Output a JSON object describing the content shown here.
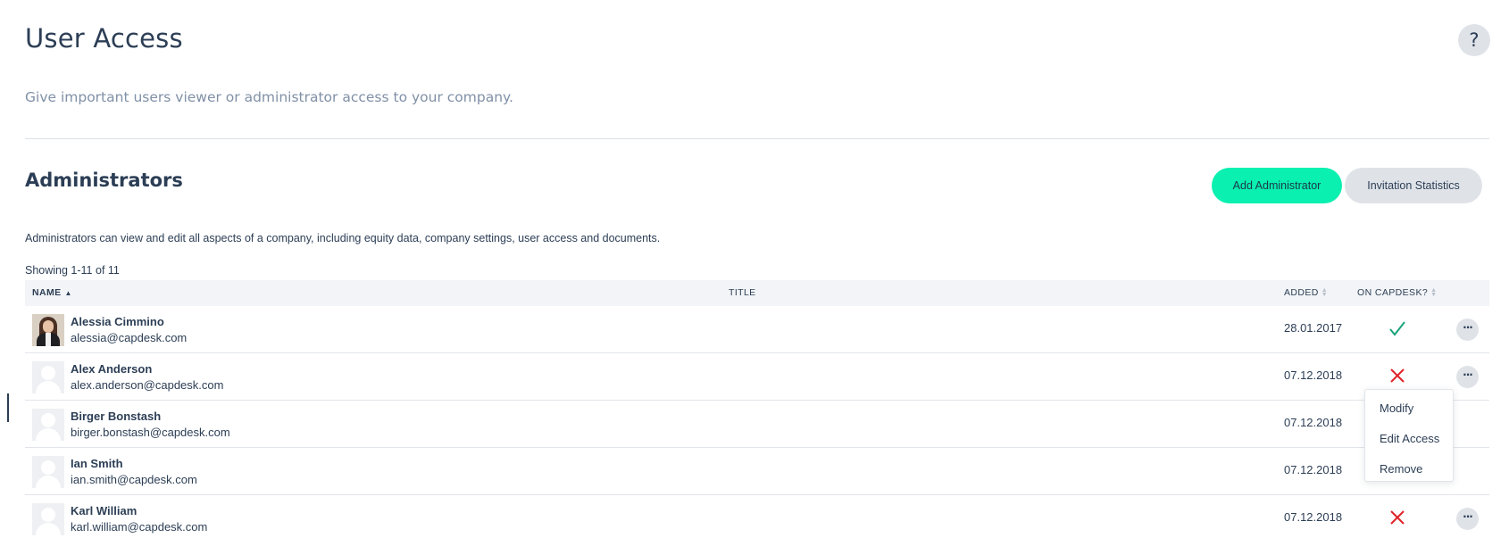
{
  "page": {
    "title": "User Access",
    "help_label": "?",
    "subtitle": "Give important users viewer or administrator access to your company."
  },
  "section": {
    "title": "Administrators",
    "add_button": "Add Administrator",
    "stats_button": "Invitation Statistics",
    "description": "Administrators can view and edit all aspects of a company, including equity data, company settings, user access and documents.",
    "showing": "Showing 1-11 of 11"
  },
  "table": {
    "columns": {
      "name": "NAME",
      "title": "TITLE",
      "added": "ADDED",
      "on_capdesk": "ON CAPDESK?"
    },
    "rows": [
      {
        "name": "Alessia Cimmino",
        "email": "alessia@capdesk.com",
        "added": "28.01.2017",
        "on_capdesk": "yes",
        "avatar": "photo"
      },
      {
        "name": "Alex Anderson",
        "email": "alex.anderson@capdesk.com",
        "added": "07.12.2018",
        "on_capdesk": "no",
        "avatar": "placeholder"
      },
      {
        "name": "Birger Bonstash",
        "email": "birger.bonstash@capdesk.com",
        "added": "07.12.2018",
        "on_capdesk": "hidden",
        "avatar": "placeholder"
      },
      {
        "name": "Ian Smith",
        "email": "ian.smith@capdesk.com",
        "added": "07.12.2018",
        "on_capdesk": "hidden",
        "avatar": "placeholder"
      },
      {
        "name": "Karl William",
        "email": "karl.william@capdesk.com",
        "added": "07.12.2018",
        "on_capdesk": "no",
        "avatar": "placeholder"
      }
    ],
    "more_label": "···"
  },
  "row_menu": {
    "items": [
      "Modify",
      "Edit Access",
      "Remove"
    ]
  },
  "colors": {
    "primary_accent": "#0af0b0",
    "text": "#2c3e55",
    "muted_text": "#8090a6",
    "success": "#1aa37a",
    "danger": "#e0242b",
    "secondary_bg": "#dfe3e8"
  },
  "icons": {
    "check": "check-icon",
    "cross": "cross-icon",
    "more": "more-horizontal-icon",
    "sort": "sort-icon",
    "help": "help-icon",
    "avatar": "user-placeholder-icon"
  }
}
